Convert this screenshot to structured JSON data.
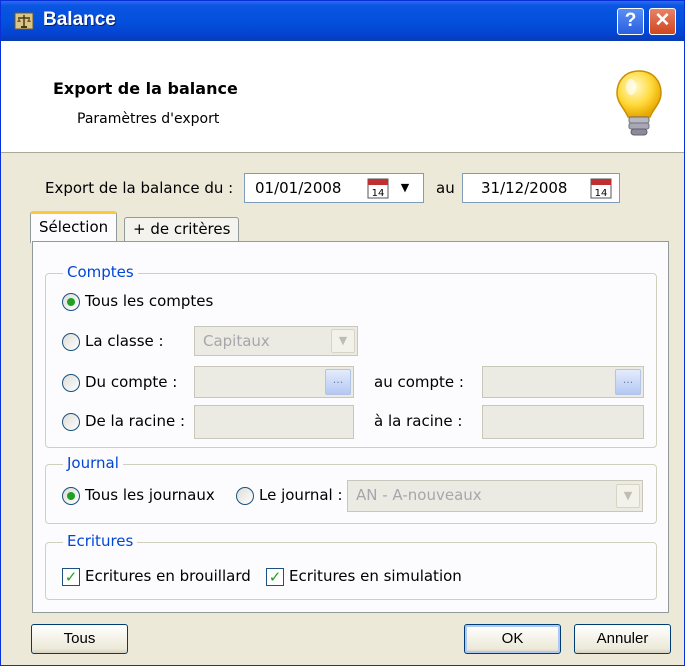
{
  "window": {
    "title": "Balance",
    "help_label": "?",
    "close_label": "✕"
  },
  "header": {
    "title": "Export de la balance",
    "subtitle": "Paramètres d'export"
  },
  "export": {
    "label_from": "Export de la balance du :",
    "date_from": "01/01/2008",
    "label_to": "au",
    "date_to": "31/12/2008",
    "calendar_day": "14"
  },
  "tabs": [
    {
      "label": "Sélection",
      "active": true
    },
    {
      "label": "+ de critères",
      "active": false
    }
  ],
  "comptes": {
    "legend": "Comptes",
    "opt_all": "Tous les comptes",
    "opt_classe": "La classe :",
    "classe_value": "Capitaux",
    "opt_compte": "Du compte :",
    "label_au_compte": "au compte :",
    "dots_label": "...",
    "opt_racine": "De la racine :",
    "label_a_racine": "à la racine :"
  },
  "journal": {
    "legend": "Journal",
    "opt_all": "Tous les journaux",
    "opt_one": "Le journal :",
    "journal_value": "AN - A-nouveaux"
  },
  "ecritures": {
    "legend": "Ecritures",
    "brouillard": "Ecritures en brouillard",
    "brouillard_checked": true,
    "simulation": "Ecritures en simulation",
    "simulation_checked": true
  },
  "buttons": {
    "all": "Tous",
    "ok": "OK",
    "cancel": "Annuler"
  },
  "colors": {
    "titlebar": "#0451dd",
    "accent": "#0046d5",
    "check": "#21a121",
    "tab_highlight": "#ffc83c"
  }
}
